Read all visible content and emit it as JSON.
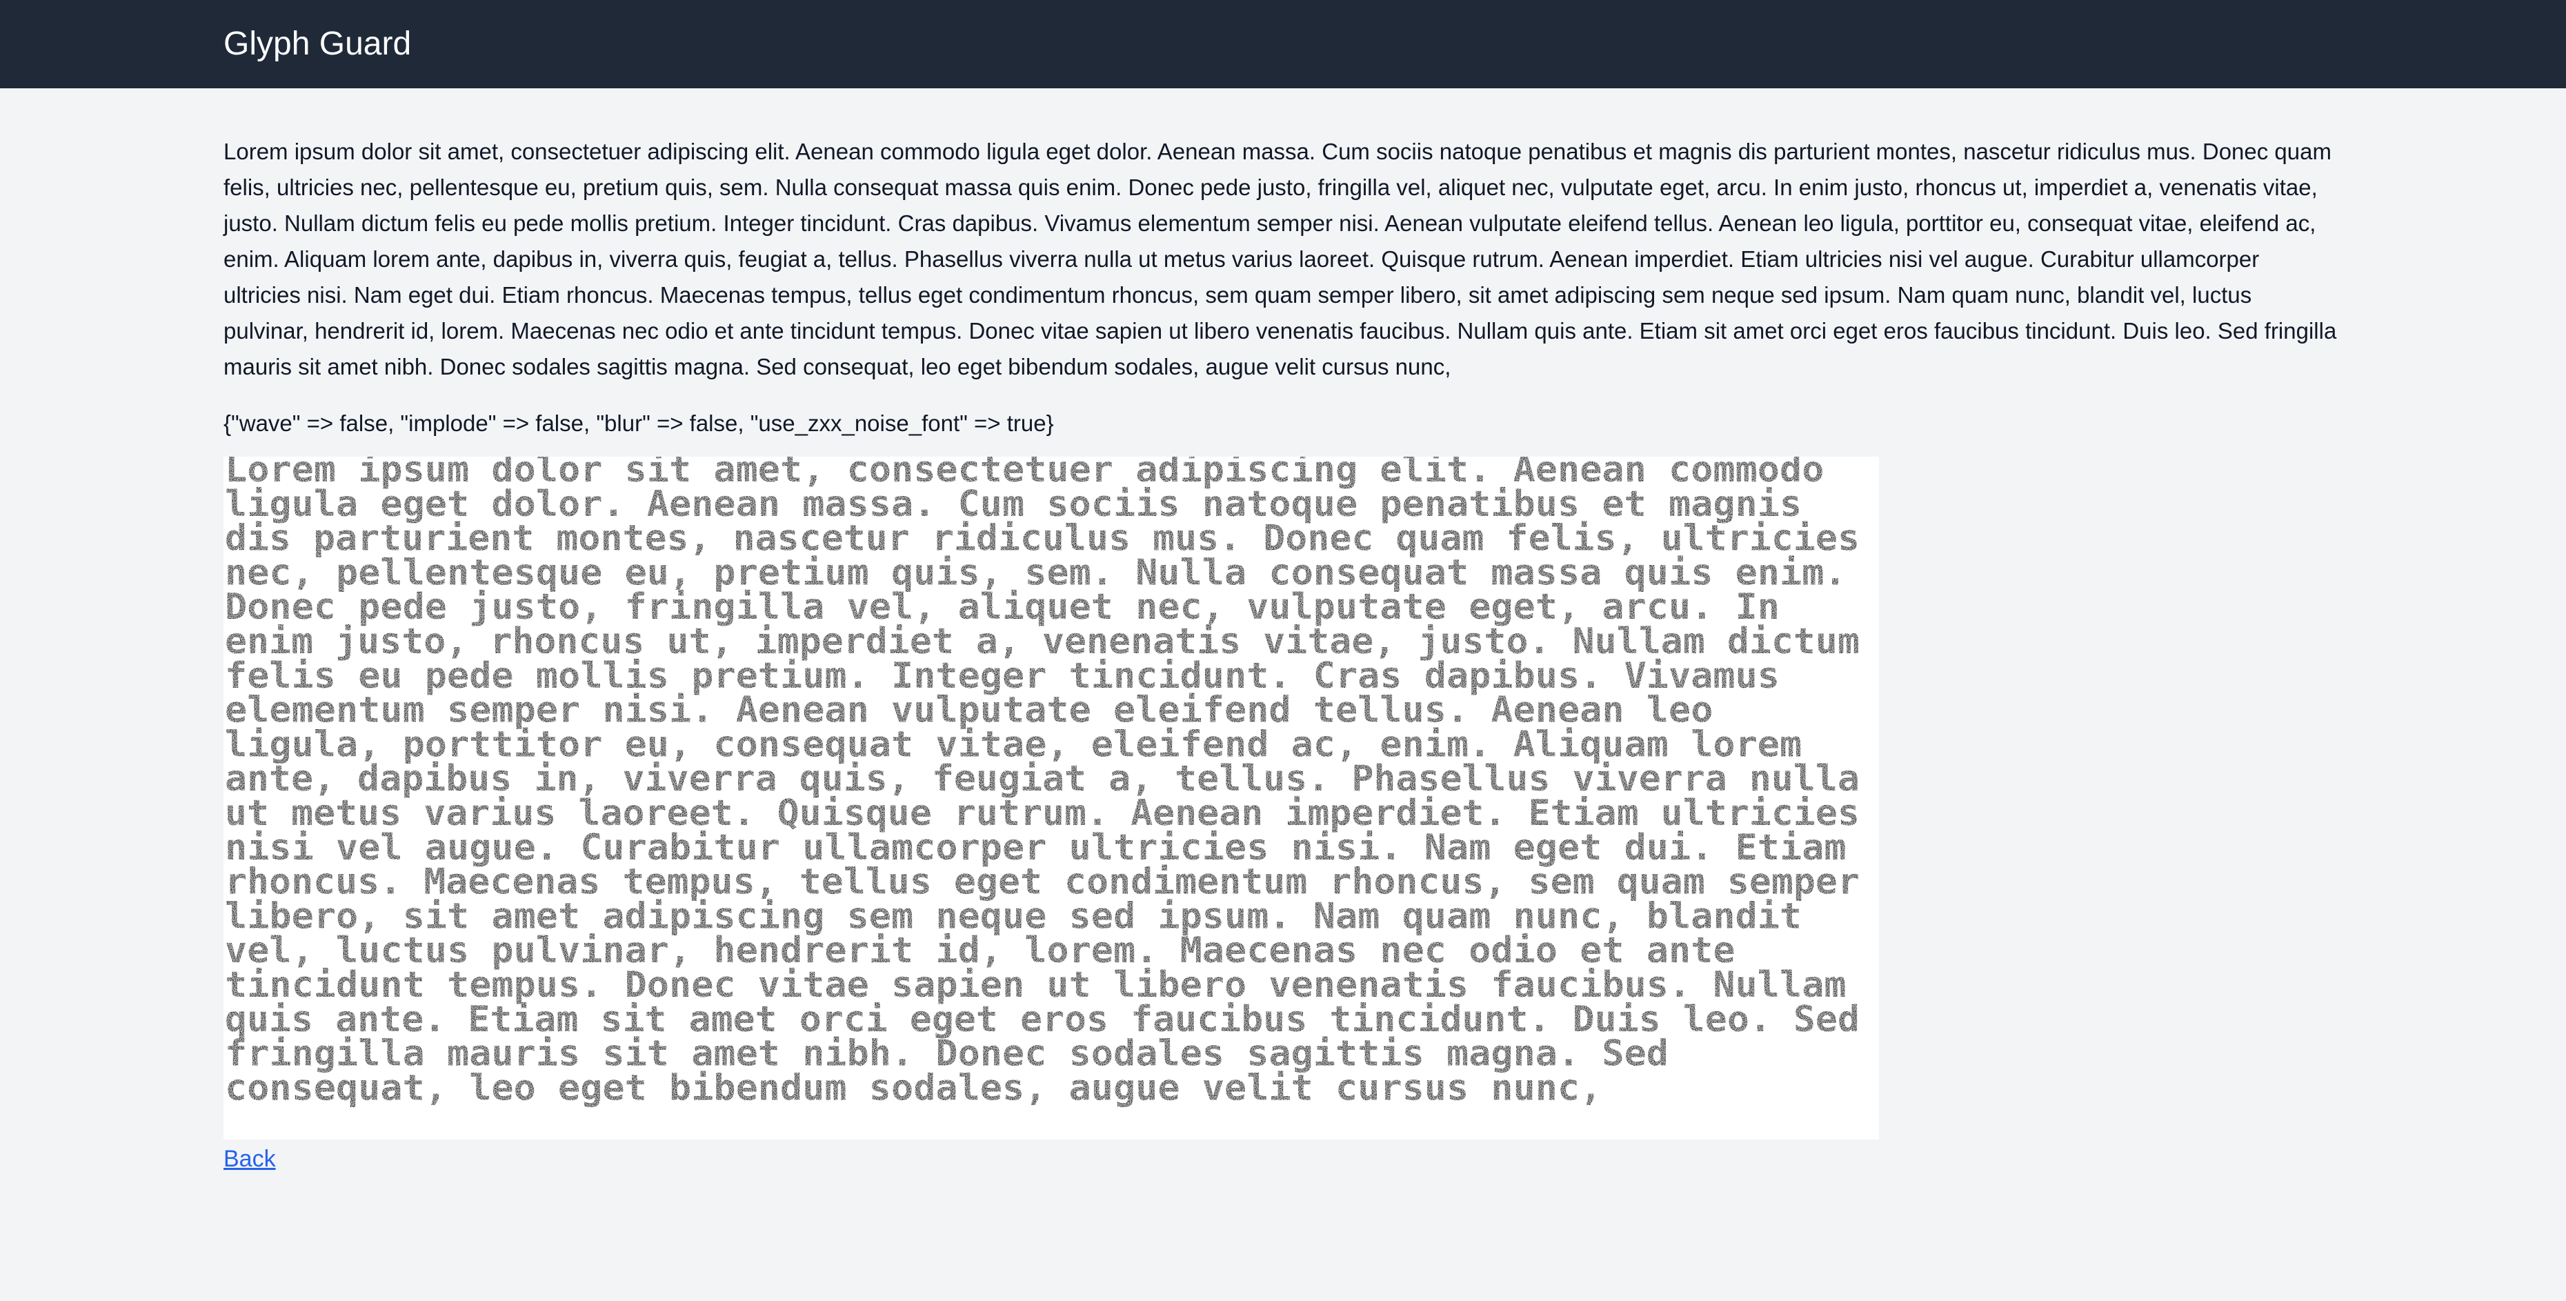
{
  "header": {
    "brand": "Glyph Guard"
  },
  "main": {
    "paragraph": "Lorem ipsum dolor sit amet, consectetuer adipiscing elit. Aenean commodo ligula eget dolor. Aenean massa. Cum sociis natoque penatibus et magnis dis parturient montes, nascetur ridiculus mus. Donec quam felis, ultricies nec, pellentesque eu, pretium quis, sem. Nulla consequat massa quis enim. Donec pede justo, fringilla vel, aliquet nec, vulputate eget, arcu. In enim justo, rhoncus ut, imperdiet a, venenatis vitae, justo. Nullam dictum felis eu pede mollis pretium. Integer tincidunt. Cras dapibus. Vivamus elementum semper nisi. Aenean vulputate eleifend tellus. Aenean leo ligula, porttitor eu, consequat vitae, eleifend ac, enim. Aliquam lorem ante, dapibus in, viverra quis, feugiat a, tellus. Phasellus viverra nulla ut metus varius laoreet. Quisque rutrum. Aenean imperdiet. Etiam ultricies nisi vel augue. Curabitur ullamcorper ultricies nisi. Nam eget dui. Etiam rhoncus. Maecenas tempus, tellus eget condimentum rhoncus, sem quam semper libero, sit amet adipiscing sem neque sed ipsum. Nam quam nunc, blandit vel, luctus pulvinar, hendrerit id, lorem. Maecenas nec odio et ante tincidunt tempus. Donec vitae sapien ut libero venenatis faucibus. Nullam quis ante. Etiam sit amet orci eget eros faucibus tincidunt. Duis leo. Sed fringilla mauris sit amet nibh. Donec sodales sagittis magna. Sed consequat, leo eget bibendum sodales, augue velit cursus nunc,",
    "config": "{\"wave\" => false, \"implode\" => false, \"blur\" => false, \"use_zxx_noise_font\" => true}",
    "captcha_lines": [
      "Lorem ipsum dolor sit amet, consectetuer adipiscing elit. Aenean commodo",
      "ligula eget dolor. Aenean massa. Cum sociis natoque penatibus et magnis",
      "dis parturient montes, nascetur ridiculus mus. Donec quam felis, ultricies",
      "nec, pellentesque eu, pretium quis, sem. Nulla consequat massa quis enim.",
      "Donec pede justo, fringilla vel, aliquet nec, vulputate eget, arcu. In",
      "enim justo, rhoncus ut, imperdiet a, venenatis vitae, justo. Nullam dictum",
      "felis eu pede mollis pretium. Integer tincidunt. Cras dapibus. Vivamus",
      "elementum semper nisi. Aenean vulputate eleifend tellus. Aenean leo",
      "ligula, porttitor eu, consequat vitae, eleifend ac, enim. Aliquam lorem",
      "ante, dapibus in, viverra quis, feugiat a, tellus. Phasellus viverra nulla",
      "ut metus varius laoreet. Quisque rutrum. Aenean imperdiet. Etiam ultricies",
      "nisi vel augue. Curabitur ullamcorper ultricies nisi. Nam eget dui. Etiam",
      "rhoncus. Maecenas tempus, tellus eget condimentum rhoncus, sem quam semper",
      "libero, sit amet adipiscing sem neque sed ipsum. Nam quam nunc, blandit",
      "vel, luctus pulvinar, hendrerit id, lorem. Maecenas nec odio et ante",
      "tincidunt tempus. Donec vitae sapien ut libero venenatis faucibus. Nullam",
      "quis ante. Etiam sit amet orci eget eros faucibus tincidunt. Duis leo. Sed",
      "fringilla mauris sit amet nibh. Donec sodales sagittis magna. Sed",
      "consequat, leo eget bibendum sodales, augue velit cursus nunc,"
    ],
    "back_label": "Back"
  },
  "colors": {
    "navbar": "#1f2937",
    "page_bg": "#f3f4f6",
    "link": "#2563eb"
  }
}
